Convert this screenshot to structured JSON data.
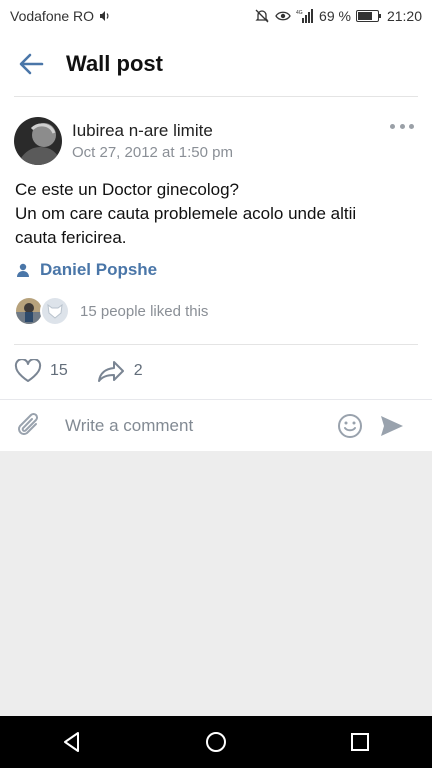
{
  "status_bar": {
    "carrier": "Vodafone RO",
    "battery_percent": "69 %",
    "time": "21:20"
  },
  "header": {
    "title": "Wall post"
  },
  "post": {
    "author": "Iubirea n-are limite",
    "date": "Oct 27, 2012 at 1:50 pm",
    "text_lines": [
      "Ce este un Doctor ginecolog?",
      "Un om care cauta problemele acolo unde altii",
      "cauta fericirea."
    ],
    "signature": "Daniel Popshe",
    "liked_text": "15 people liked this",
    "likes_count": "15",
    "shares_count": "2"
  },
  "composer": {
    "placeholder": "Write a comment"
  },
  "colors": {
    "accent": "#4a76a8",
    "muted": "#8a8f96",
    "divider": "#e4e4e4",
    "background_gray": "#ededed"
  },
  "icons": {
    "back": "arrow-left-icon",
    "more": "more-horizontal-icon",
    "user": "user-icon",
    "like": "heart-icon",
    "share": "share-arrow-icon",
    "attach": "paperclip-icon",
    "emoji": "smiley-icon",
    "send": "send-icon"
  }
}
